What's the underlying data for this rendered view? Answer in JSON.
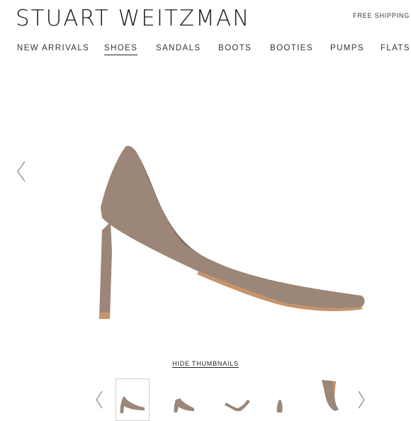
{
  "brand": {
    "name": "STUART WEITZMAN"
  },
  "header": {
    "shipping": "FREE SHIPPING"
  },
  "nav": {
    "items": [
      {
        "label": "NEW ARRIVALS",
        "active": false
      },
      {
        "label": "SHOES",
        "active": true
      },
      {
        "label": "SANDALS",
        "active": false
      },
      {
        "label": "BOOTS",
        "active": false
      },
      {
        "label": "BOOTIES",
        "active": false
      },
      {
        "label": "PUMPS",
        "active": false
      },
      {
        "label": "FLATS",
        "active": false
      }
    ]
  },
  "gallery": {
    "prev_icon": "chevron-left-icon",
    "next_icon": "chevron-right-icon",
    "hide_thumbnails_label": "HIDE THUMBNAILS",
    "thumbnail_count": 5,
    "selected_thumbnail": 1
  },
  "colors": {
    "suede": "#9c8677",
    "suede_shadow": "#7d685b",
    "sole": "#c7936a",
    "text": "#222222"
  }
}
